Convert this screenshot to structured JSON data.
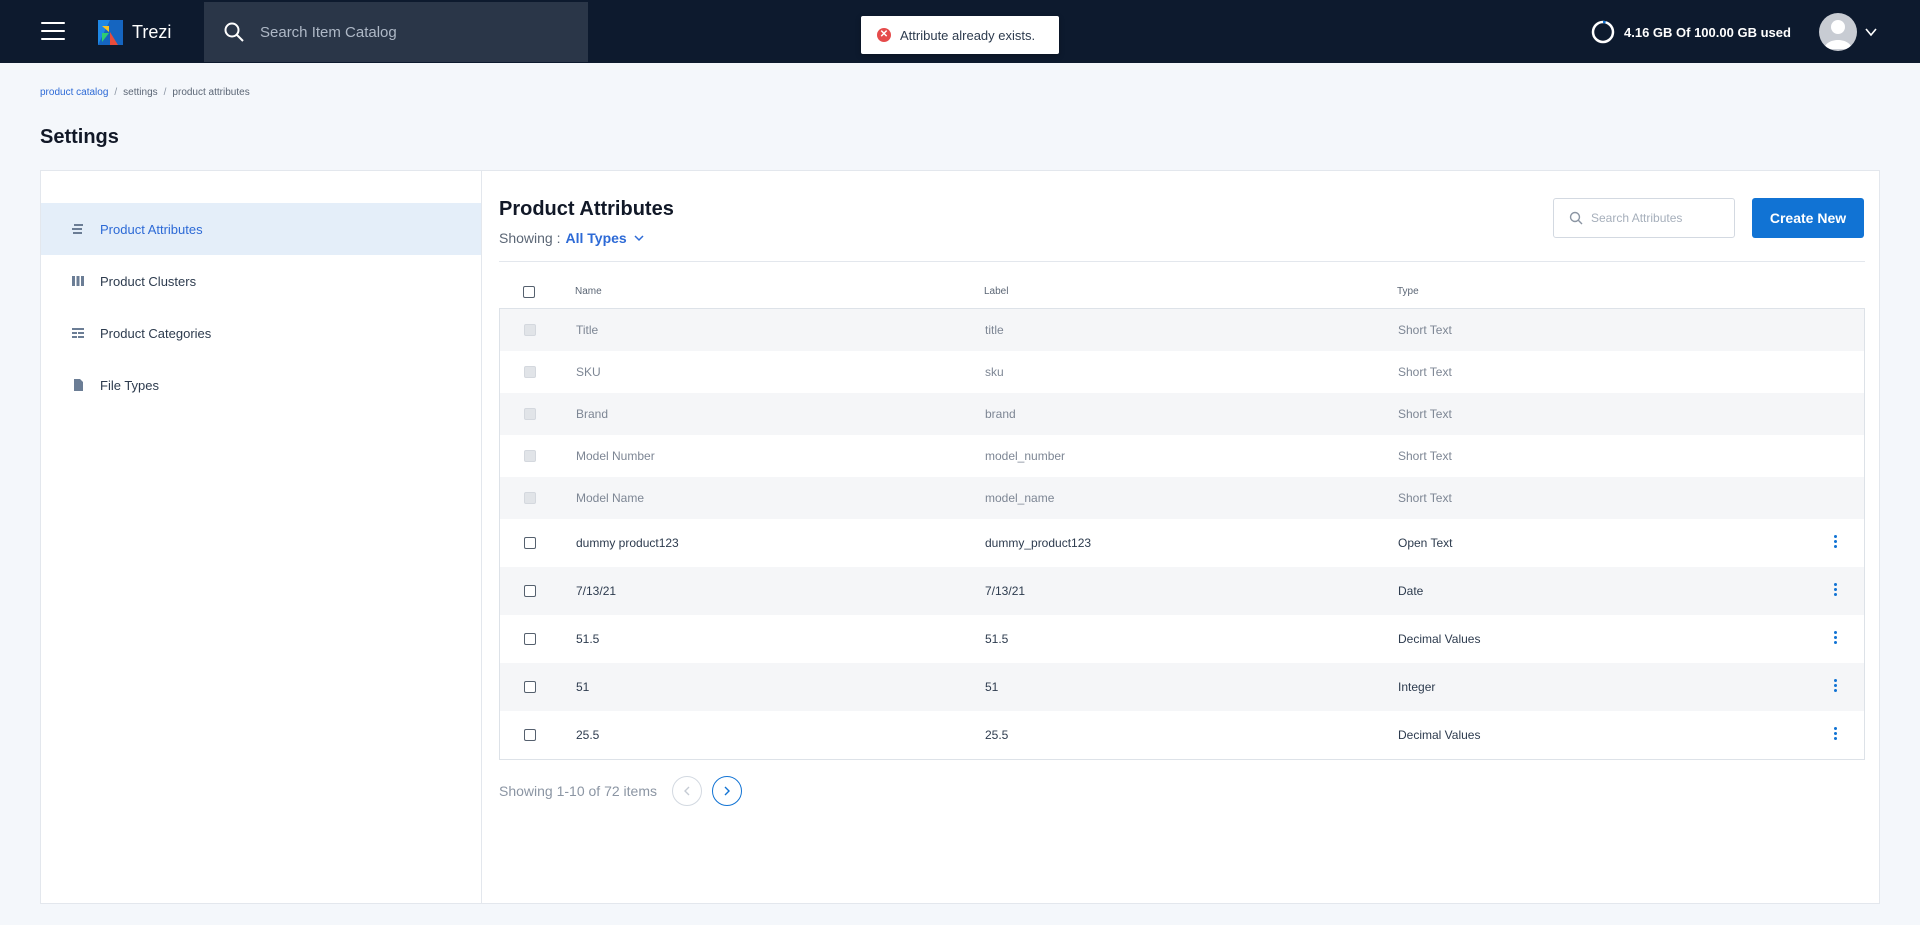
{
  "header": {
    "brand": "Trezi",
    "search_placeholder": "Search Item Catalog",
    "toast": "Attribute already exists.",
    "storage": "4.16 GB Of 100.00 GB used",
    "storage_used_fraction": 0.0416
  },
  "breadcrumb": [
    "product catalog",
    "settings",
    "product attributes"
  ],
  "page_title": "Settings",
  "sidebar": {
    "items": [
      {
        "label": "Product Attributes",
        "icon": "attributes-icon",
        "active": true
      },
      {
        "label": "Product Clusters",
        "icon": "clusters-icon",
        "active": false
      },
      {
        "label": "Product Categories",
        "icon": "categories-icon",
        "active": false
      },
      {
        "label": "File Types",
        "icon": "file-icon",
        "active": false
      }
    ]
  },
  "main": {
    "title": "Product Attributes",
    "showing_label": "Showing :",
    "filter_value": "All Types",
    "search_placeholder": "Search Attributes",
    "create_label": "Create New",
    "columns": [
      "Name",
      "Label",
      "Type"
    ],
    "rows": [
      {
        "name": "Title",
        "label": "title",
        "type": "Short Text",
        "locked": true
      },
      {
        "name": "SKU",
        "label": "sku",
        "type": "Short Text",
        "locked": true
      },
      {
        "name": "Brand",
        "label": "brand",
        "type": "Short Text",
        "locked": true
      },
      {
        "name": "Model Number",
        "label": "model_number",
        "type": "Short Text",
        "locked": true
      },
      {
        "name": "Model Name",
        "label": "model_name",
        "type": "Short Text",
        "locked": true
      },
      {
        "name": "dummy product123",
        "label": "dummy_product123",
        "type": "Open Text",
        "locked": false
      },
      {
        "name": "7/13/21",
        "label": "7/13/21",
        "type": "Date",
        "locked": false
      },
      {
        "name": "51.5",
        "label": "51.5",
        "type": "Decimal Values",
        "locked": false
      },
      {
        "name": "51",
        "label": "51",
        "type": "Integer",
        "locked": false
      },
      {
        "name": "25.5",
        "label": "25.5",
        "type": "Decimal Values",
        "locked": false
      }
    ],
    "pagination": "Showing 1-10 of 72 items"
  },
  "colors": {
    "topbar": "#0d1a2e",
    "accent": "#1173d4",
    "error": "#e54b4b"
  }
}
